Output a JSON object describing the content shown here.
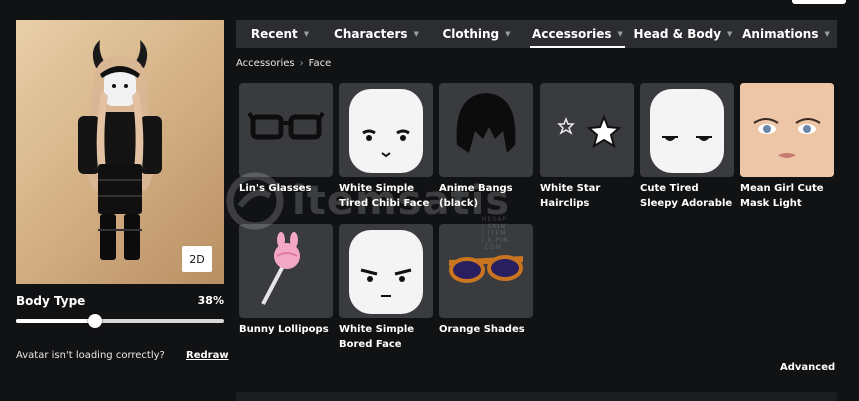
{
  "tabs": [
    {
      "label": "Recent",
      "active": false
    },
    {
      "label": "Characters",
      "active": false
    },
    {
      "label": "Clothing",
      "active": false
    },
    {
      "label": "Accessories",
      "active": true
    },
    {
      "label": "Head & Body",
      "active": false
    },
    {
      "label": "Animations",
      "active": false
    }
  ],
  "breadcrumb": {
    "parent": "Accessories",
    "current": "Face"
  },
  "items": [
    {
      "name": "Lin's Glasses",
      "icon": "black-glasses-icon"
    },
    {
      "name": "White Simple Tired Chibi Face",
      "icon": "tired-chibi-face-icon"
    },
    {
      "name": "Anime Bangs (black)",
      "icon": "black-bangs-icon"
    },
    {
      "name": "White Star Hairclips",
      "icon": "star-hairclips-icon"
    },
    {
      "name": "Cute Tired Sleepy Adorable Eyes wit...",
      "icon": "sleepy-eyes-face-icon"
    },
    {
      "name": "Mean Girl Cute Mask Light Brown",
      "icon": "mask-face-icon"
    },
    {
      "name": "Bunny Lollipops",
      "icon": "bunny-lollipop-icon"
    },
    {
      "name": "White Simple Bored Face",
      "icon": "bored-face-icon"
    },
    {
      "name": "Orange Shades",
      "icon": "orange-shades-icon"
    }
  ],
  "preview": {
    "toggle_label": "2D"
  },
  "body_type": {
    "label": "Body Type",
    "value_text": "38%",
    "value": 0.38
  },
  "loading": {
    "message": "Avatar isn't loading correctly?",
    "redraw_label": "Redraw"
  },
  "advanced_label": "Advanced",
  "watermark": {
    "text": "itemsatis",
    "subtext": "HESAP / SKIN / ITEM / E-PIN .COM"
  },
  "colors": {
    "background": "#111214",
    "tab_bar": "#2b2d31",
    "tile": "#393b3f",
    "text": "#ffffff"
  }
}
